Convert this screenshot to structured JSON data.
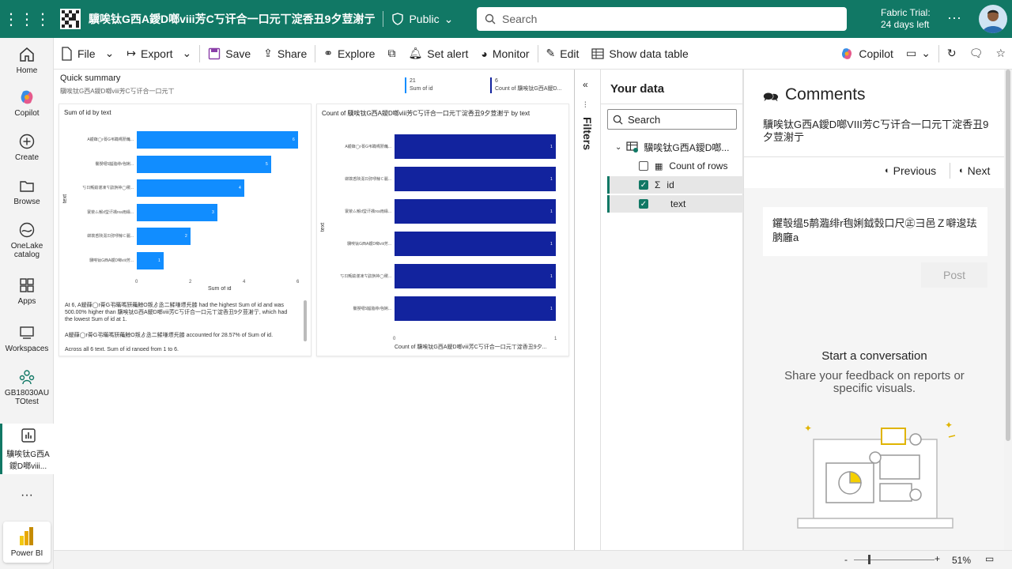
{
  "topbar": {
    "title": "驥唉钛G西A鑀D啷viii芳C丂讦合一口元丅淀㕿丑9夕荳㴬亍",
    "visibility": "Public",
    "search_placeholder": "Search",
    "trial_line1": "Fabric Trial:",
    "trial_line2": "24 days left",
    "more": "···"
  },
  "leftnav": {
    "items": [
      {
        "label": "Home"
      },
      {
        "label": "Copilot"
      },
      {
        "label": "Create"
      },
      {
        "label": "Browse"
      },
      {
        "label": "OneLake catalog"
      },
      {
        "label": "Apps"
      },
      {
        "label": "Workspaces"
      },
      {
        "label": "GB18030AUTOtest"
      },
      {
        "label": "驥唉钛G西A鑀D啷viii..."
      }
    ],
    "more": "···",
    "powerbi_label": "Power BI"
  },
  "toolbar": {
    "file": "File",
    "export": "Export",
    "save": "Save",
    "share": "Share",
    "explore": "Explore",
    "set_alert": "Set alert",
    "monitor": "Monitor",
    "edit": "Edit",
    "show_data_table": "Show data table",
    "copilot": "Copilot"
  },
  "report": {
    "summary_title": "Quick summary",
    "summary_sub": "驥唉钛G西A鑀D啷viii芳C丂讦合一口元丅",
    "kpi1_value": "21",
    "kpi1_label": "Sum of id",
    "kpi2_value": "6",
    "kpi2_label": "Count of 驥唉钛G西A鑀D...",
    "narrative1": "At 6, A鑀蕼◯r蓇G弔瞞嗎豜蘒鯨O叛ゟ丞二鰇嗛墂㒫膝 had the highest Sum of id and was 500.00% higher than 驥唉钛G西A鑀D啷viii芳C丂讦合一口元丅淀㕿丑9夕荳㴬亍, which had the lowest Sum of id at 1.",
    "narrative2": "A鑀蕼◯r蓇G弔瞞嗎豜蘒鯨O叛ゟ丞二鰇嗛墂㒫膝 accounted for 28.57% of Sum of id.",
    "narrative3": "Across all 6 text, Sum of id ranged from 1 to 6."
  },
  "chart_data": [
    {
      "type": "bar",
      "title": "Sum of id by text",
      "xlabel": "Sum of id",
      "ylabel": "text",
      "categories": [
        "A鑀蕼◯r蓇G弔瞞嗎豜蘒...",
        "鸒猰噶5齰瀶绯r毥娳...",
        "丂ㄖ甒鎱谨凍ㄘ鼤旃祌◯稷...",
        "寰荥ㄙ鯸d瑩讦禑rxa雨緣...",
        "㱍簔㕿陝涰ㄖ弥嘐鯨ㄷ麗...",
        "驥唉钛G西A鑀D啷viii芳..."
      ],
      "values": [
        6,
        5,
        4,
        3,
        2,
        1
      ],
      "xticks": [
        "0",
        "2",
        "4",
        "6"
      ],
      "xlim": [
        0,
        6
      ],
      "color": "#118dff"
    },
    {
      "type": "bar",
      "title": "Count of 驥唉钛G西A鑀D啷viii芳C丂讦合一口元丅淀㕿丑9夕荳㴬亍 by text",
      "xlabel": "Count of 驥唉钛G西A鑀D啷viii芳C丂讦合一口元丅淀㕿丑9夕...",
      "ylabel": "text",
      "categories": [
        "A鑀蕼◯r蓇G弔瞞嗎豜蘒...",
        "㱍簔㕿陝涰ㄖ弥嘐鯨ㄷ麗...",
        "寰荥ㄙ鯸d瑩讦禑rxa雨緣...",
        "驥唉钛G西A鑀D啷viii芳...",
        "丂ㄖ甒鎱谨凍ㄘ鼤旃祌◯稷...",
        "鸒猰噶5齰瀶绯r毥娳..."
      ],
      "values": [
        1,
        1,
        1,
        1,
        1,
        1
      ],
      "xticks": [
        "0",
        "1"
      ],
      "xlim": [
        0,
        1
      ],
      "color": "#12239e"
    }
  ],
  "filters": {
    "label": "Filters"
  },
  "your_data": {
    "title": "Your data",
    "search_placeholder": "Search",
    "table_name": "驥唉钛G西A鑀D啷...",
    "fields": [
      {
        "label": "Count of rows",
        "checked": false,
        "icon": "calculator-icon"
      },
      {
        "label": "id",
        "checked": true,
        "icon": "sigma-icon"
      },
      {
        "label": "text",
        "checked": true,
        "icon": ""
      }
    ]
  },
  "comments": {
    "title": "Comments",
    "subtitle": "驥唉钛G西A鑀D啷VIII芳C丂讦合一口元丅淀㕿丑9夕荳㴬亍",
    "previous": "Previous",
    "next": "Next",
    "draft": "鑺彀缊5䴖瀶绯r毥娳鉞㲄口尺㊣彐邑Ｚ噼逡珐朒廱a",
    "post": "Post",
    "start_title": "Start a conversation",
    "start_sub": "Share your feedback on reports or specific visuals."
  },
  "status": {
    "zoom": "51%"
  }
}
